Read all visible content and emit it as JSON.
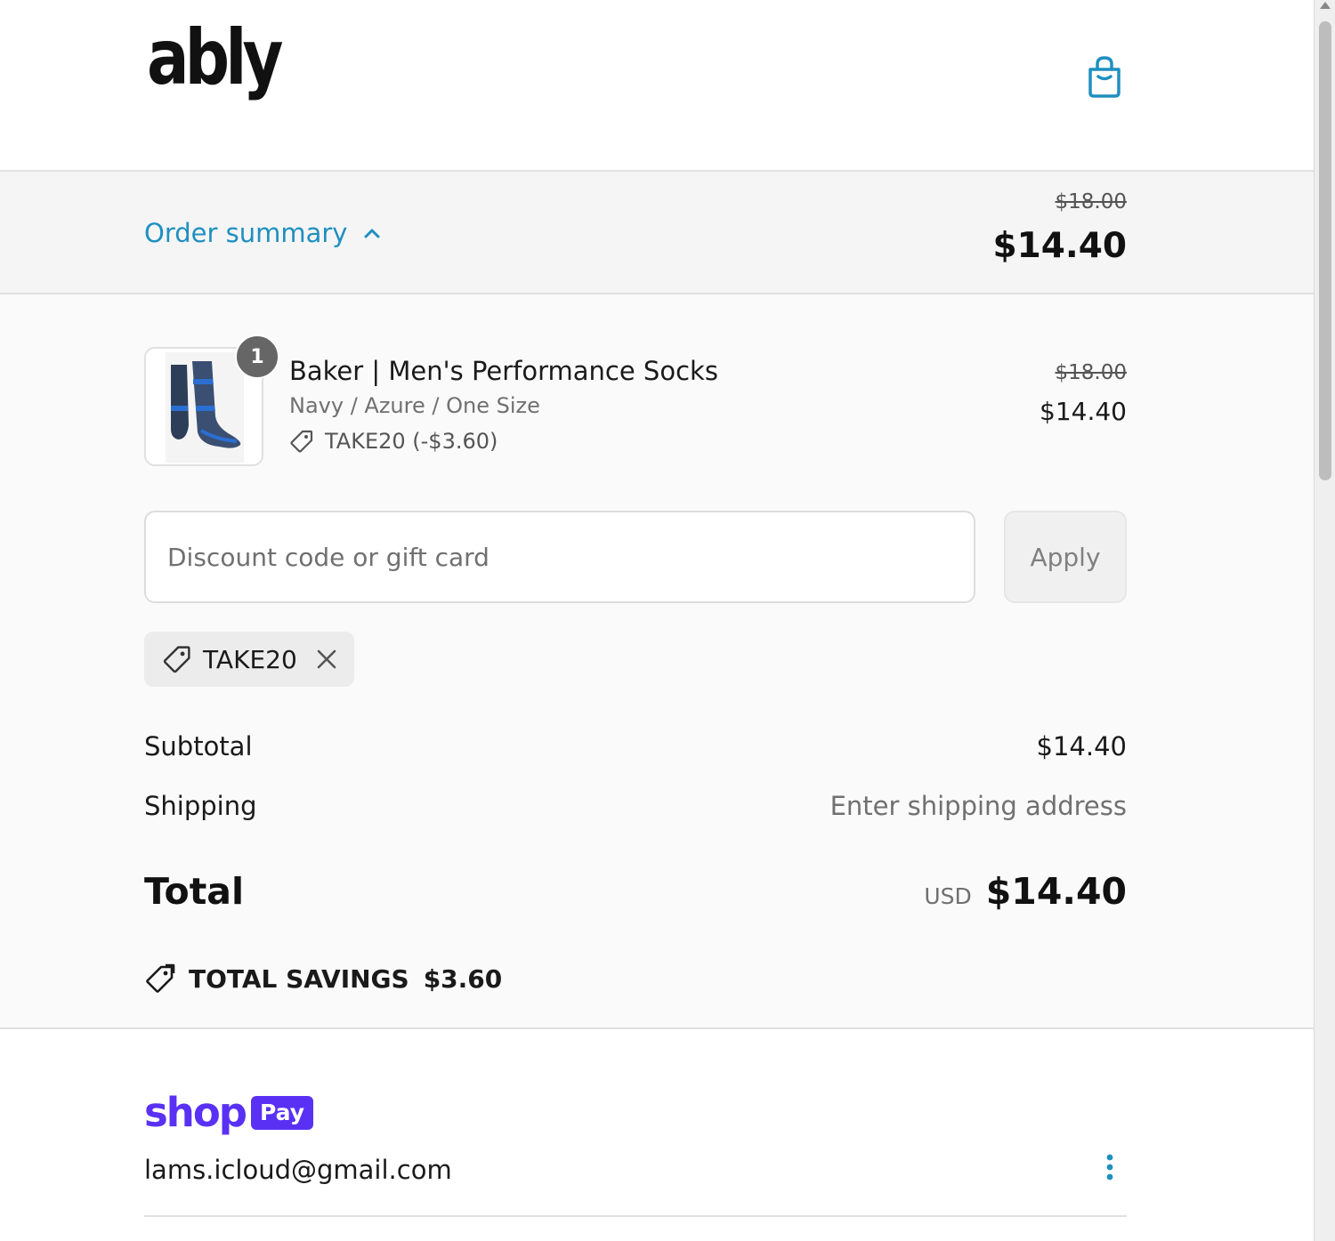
{
  "header": {
    "logo_text": "ably",
    "cart_icon": "shopping-bag-icon"
  },
  "order_summary": {
    "toggle_label": "Order summary",
    "toggle_icon": "chevron-up-icon",
    "original_total": "$18.00",
    "total": "$14.40"
  },
  "line_item": {
    "quantity": "1",
    "title": "Baker | Men's Performance Socks",
    "variant": "Navy / Azure / One Size",
    "discount": "TAKE20 (-$3.60)",
    "original_price": "$18.00",
    "price": "$14.40"
  },
  "discount_form": {
    "placeholder": "Discount code or gift card",
    "apply_label": "Apply",
    "applied_code": "TAKE20"
  },
  "totals": {
    "subtotal_label": "Subtotal",
    "subtotal_value": "$14.40",
    "shipping_label": "Shipping",
    "shipping_value": "Enter shipping address",
    "total_label": "Total",
    "currency": "USD",
    "total_value": "$14.40",
    "savings_label": "TOTAL SAVINGS",
    "savings_value": "$3.60"
  },
  "shop_pay": {
    "shop_text": "shop",
    "pay_text": "Pay",
    "email": "lams.icloud@gmail.com"
  },
  "colors": {
    "accent": "#1f8fc0",
    "shop_pay": "#5a31f4"
  }
}
